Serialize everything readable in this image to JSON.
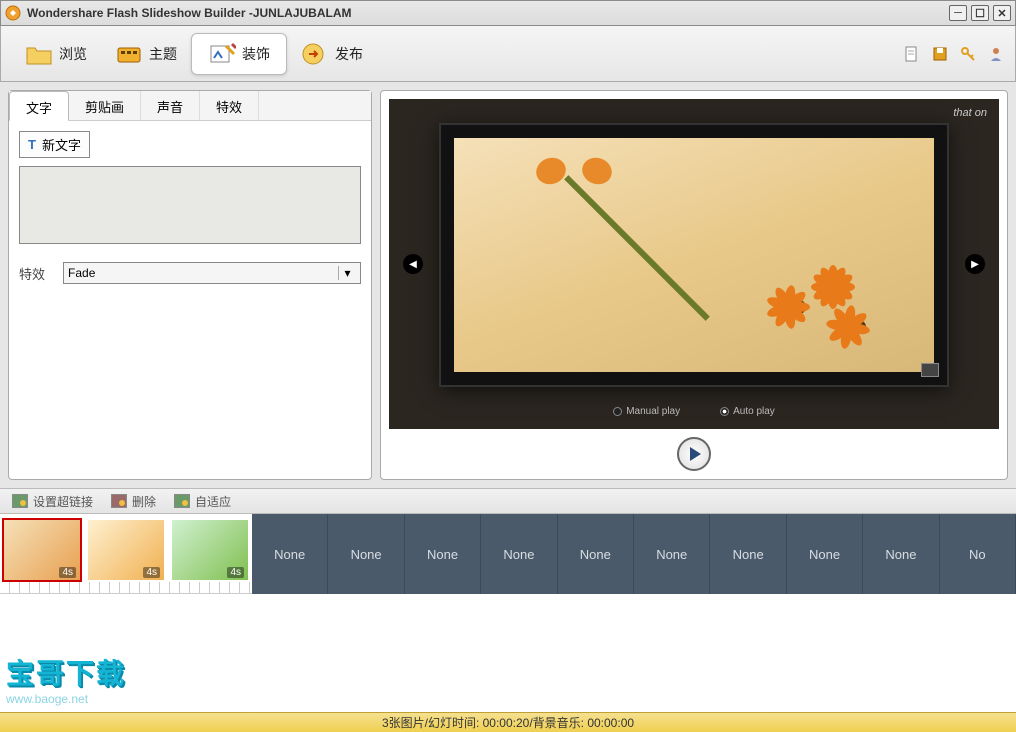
{
  "title": "Wondershare Flash Slideshow Builder -JUNLAJUBALAM",
  "toolbar": {
    "browse": "浏览",
    "theme": "主题",
    "decorate": "装饰",
    "publish": "发布"
  },
  "subtabs": {
    "text": "文字",
    "clipart": "剪贴画",
    "sound": "声音",
    "effect": "特效"
  },
  "panel": {
    "new_text": "新文字",
    "effect_label": "特效",
    "effect_value": "Fade"
  },
  "preview": {
    "brand": "that on",
    "manual": "Manual play",
    "auto": "Auto play"
  },
  "strip": {
    "hyperlink": "设置超链接",
    "delete": "删除",
    "fit": "自适应"
  },
  "thumbs": {
    "d1": "4s",
    "d2": "4s",
    "d3": "4s",
    "none": "None"
  },
  "status": "3张图片/幻灯时间: 00:00:20/背景音乐: 00:00:00",
  "watermark": {
    "big": "宝哥下载",
    "small": "www.baoge.net"
  }
}
